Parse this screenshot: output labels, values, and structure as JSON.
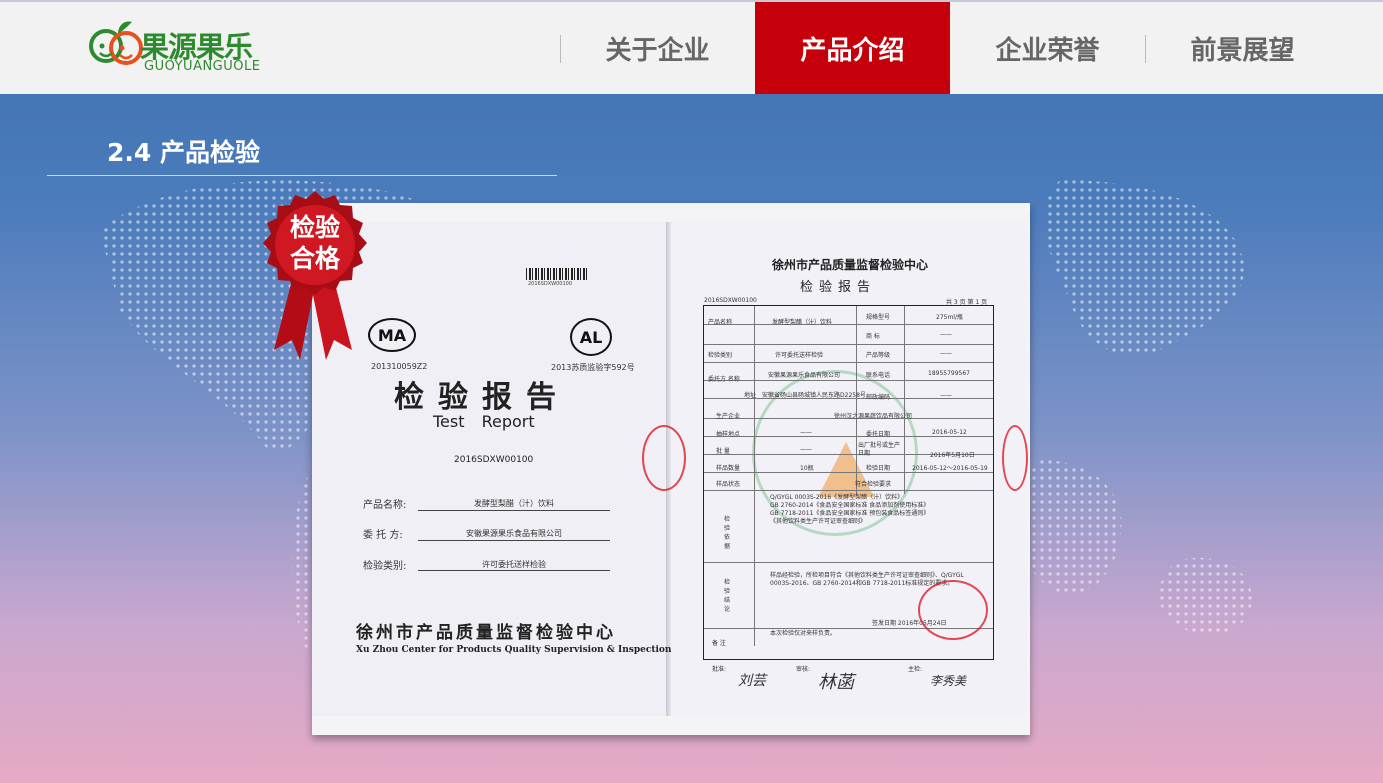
{
  "logo": {
    "name": "果源果乐",
    "latin": "GUOYUANGUOLE"
  },
  "nav": {
    "items": [
      {
        "label": "关于企业"
      },
      {
        "label": "产品介绍"
      },
      {
        "label": "企业荣誉"
      },
      {
        "label": "前景展望"
      }
    ],
    "active_index": 1
  },
  "section": {
    "title": "2.4 产品检验"
  },
  "badge": {
    "line1": "检验",
    "line2": "合格",
    "color": "#c0101a"
  },
  "report_cover": {
    "barcode_number": "2016SDXW00100",
    "cma_code": "201310059Z2",
    "cal_code": "2013苏质监验字592号",
    "title_cn": "检验报告",
    "title_en": "Test Report",
    "report_number": "2016SDXW00100",
    "fields": [
      {
        "label": "产品名称:",
        "value": "发酵型梨醋（汁）饮料"
      },
      {
        "label": "委 托 方:",
        "value": "安徽果源果乐食品有限公司"
      },
      {
        "label": "检验类别:",
        "value": "许可委托送样检验"
      }
    ],
    "org_cn": "徐州市产品质量监督检验中心",
    "org_en": "Xu Zhou Center for Products Quality Supervision & Inspection"
  },
  "report_detail": {
    "org": "徐州市产品质量监督检验中心",
    "title": "检验报告",
    "number": "2016SDXW00100",
    "page": "共 3 页 第 1 页",
    "rows": [
      {
        "label": "产品名称",
        "value": "发酵型梨醋（汁）饮料",
        "label2": "规格型号",
        "value2": "275ml/瓶"
      },
      {
        "label": "",
        "value": "",
        "label2": "商 标",
        "value2": "——"
      },
      {
        "label": "检验类别",
        "value": "许可委托送样检验",
        "label2": "产品等级",
        "value2": "——"
      },
      {
        "label": "委托方 名称",
        "value": "安徽果源果乐食品有限公司",
        "label2": "联系电话",
        "value2": "18955799567"
      },
      {
        "label": "地址",
        "value": "安徽省砀山县砀城镇人民东路D2258号",
        "label2": "邮政编码",
        "value2": "——"
      },
      {
        "label": "生产企业",
        "value": "徐州汉之源果蔬饮品有限公司",
        "label2": "",
        "value2": ""
      },
      {
        "label": "抽样地点",
        "value": "——",
        "label2": "委托日期",
        "value2": "2016-05-12"
      },
      {
        "label": "批 量",
        "value": "——",
        "label2": "出厂批号或生产日期",
        "value2": "2016年5月10日"
      },
      {
        "label": "样品数量",
        "value": "10瓶",
        "label2": "检验日期",
        "value2": "2016-05-12～2016-05-19"
      },
      {
        "label": "样品状态",
        "value": "符合检验要求",
        "label2": "",
        "value2": ""
      }
    ],
    "basis_label": "检验依据",
    "basis": [
      "Q/GYGL 0003S-2016《发酵型梨醋（汁）饮料》",
      "GB 2760-2014《食品安全国家标准 食品添加剂使用标准》",
      "GB 7718-2011《食品安全国家标准 预包装食品标签通则》",
      "《其他饮料类生产许可证审查细则》"
    ],
    "conclusion_label": "检验结论",
    "conclusion": [
      "样品经检验，所检项目符合《其他饮料类生产许可证审查细则》、Q/GYGL",
      "0003S-2016、GB 2760-2014和GB 7718-2011标准规定的要求。"
    ],
    "sign_date": "签发日期 2016年05月24日",
    "remark_label": "备 注",
    "remark": "本次检验仅对来样负责。",
    "approve_label": "批准:",
    "review_label": "审核:",
    "inspect_label": "主检:",
    "sig1": "刘芸",
    "sig2": "林菡",
    "sig3": "李秀美"
  }
}
